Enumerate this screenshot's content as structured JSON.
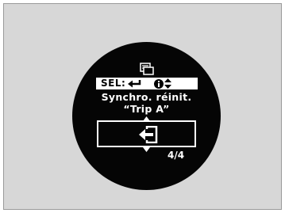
{
  "display": {
    "select_label": "SEL:",
    "message_line1": "Synchro. réinit.",
    "message_line2": "“Trip A”",
    "page_indicator": "4/4"
  },
  "icons": {
    "menu": "menu-screen-icon",
    "enter": "enter-return-icon",
    "info": "info-icon",
    "updown": "up-down-arrows-icon",
    "exit": "exit-door-arrow-icon"
  },
  "colors": {
    "background": "#d7d7d7",
    "dial": "#050505",
    "text": "#ffffff"
  }
}
